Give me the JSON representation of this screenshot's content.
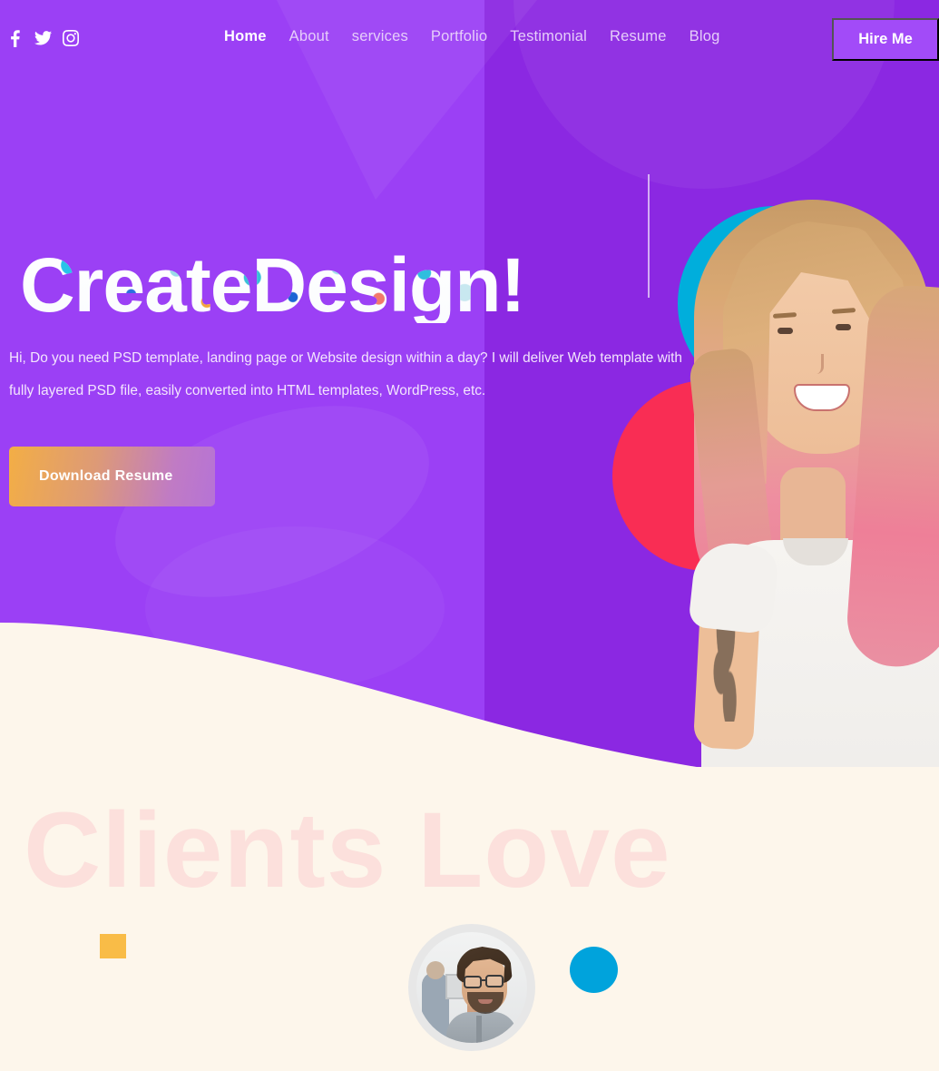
{
  "header": {
    "socials": [
      {
        "name": "facebook-icon",
        "label": "Facebook"
      },
      {
        "name": "twitter-icon",
        "label": "Twitter"
      },
      {
        "name": "instagram-icon",
        "label": "Instagram"
      }
    ],
    "nav": [
      {
        "label": "Home",
        "active": true
      },
      {
        "label": "About",
        "active": false
      },
      {
        "label": "services",
        "active": false
      },
      {
        "label": "Portfolio",
        "active": false
      },
      {
        "label": "Testimonial",
        "active": false
      },
      {
        "label": "Resume",
        "active": false
      },
      {
        "label": "Blog",
        "active": false
      }
    ],
    "cta_label": "Hire Me"
  },
  "hero": {
    "headline": "CreateDesign!",
    "paragraph": "Hi, Do you need PSD template, landing page or Website design within a day? I will deliver Web template with fully layered PSD file, easily converted into HTML templates, WordPress, etc.",
    "button_label": "Download Resume",
    "portrait_alt": "smiling-woman-portrait"
  },
  "testimonial": {
    "watermark": "Clients Love",
    "avatar_alt": "man-with-glasses-avatar"
  },
  "colors": {
    "purple_left": "#9B40F5",
    "purple_right": "#8B28E2",
    "hire_button": "#A24BF8",
    "cream": "#FDF6EB",
    "watermark_pink": "#FCE0DC",
    "accent_blue": "#00A3DC",
    "accent_orange": "#F9BC47",
    "accent_red": "#F92D54",
    "accent_cyan": "#00AEDC",
    "accent_yellow": "#F9B23F",
    "cta_gradient_start": "#F3AE45",
    "cta_gradient_end": "#B673D6"
  }
}
